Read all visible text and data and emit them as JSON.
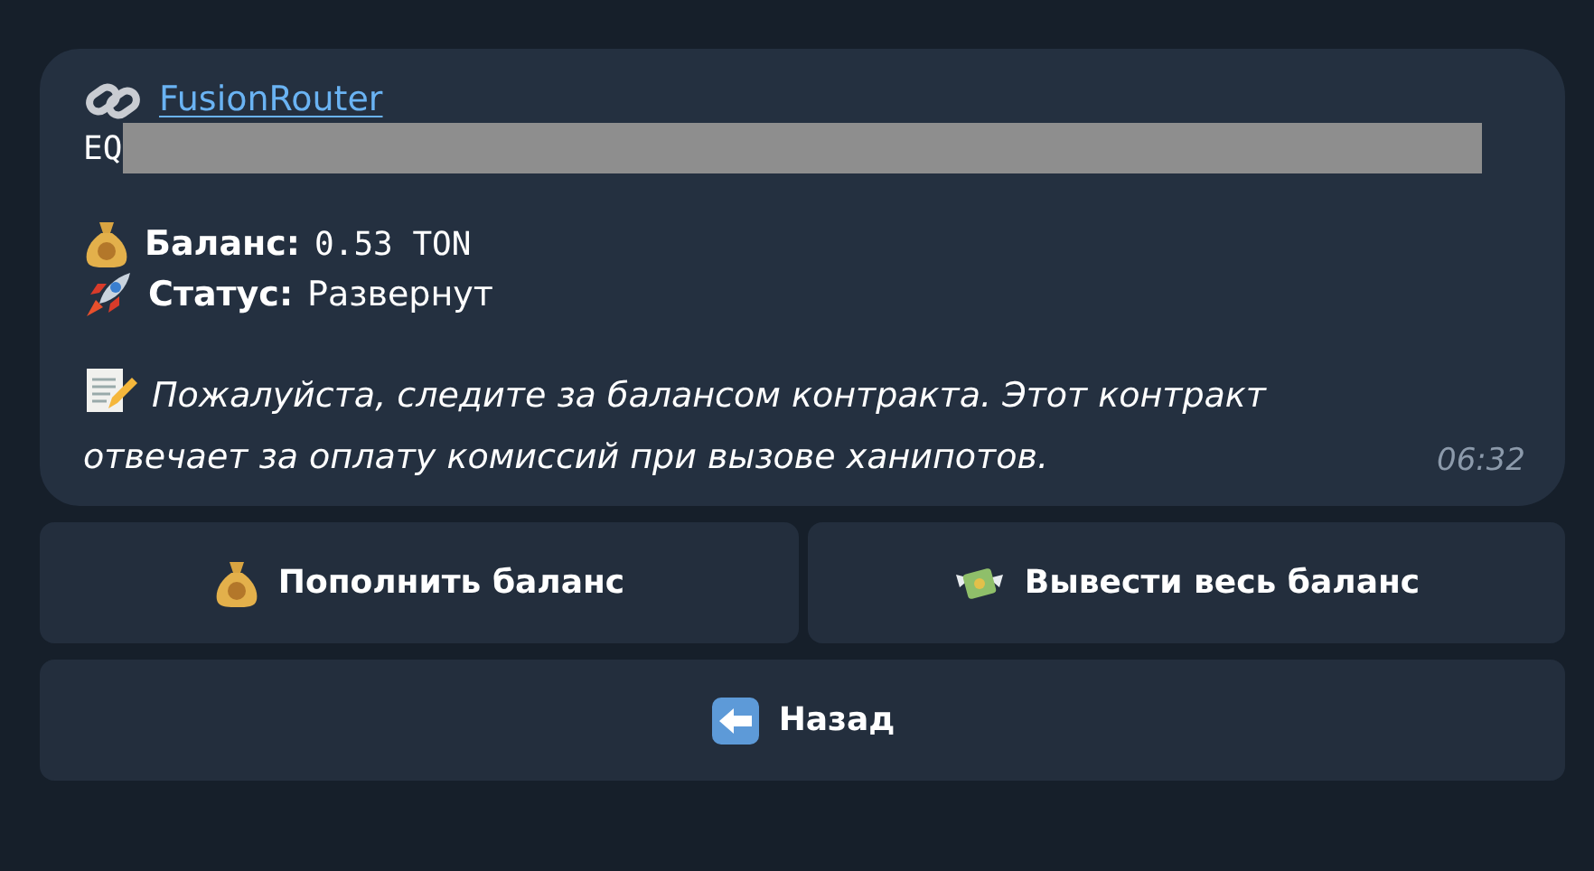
{
  "message": {
    "title_link": "FusionRouter",
    "address": {
      "text": "EQ",
      "redacted": true
    },
    "fields": [
      {
        "kind": "balance",
        "label": "Баланс:",
        "value": "0.53 TON"
      },
      {
        "kind": "status",
        "label": "Статус:",
        "value": "Развернут"
      }
    ],
    "note": "Пожалуйста, следите за балансом контракта. Этот контракт отвечает за оплату комиссий при вызове ханипотов.",
    "time": "06:32"
  },
  "buttons": [
    [
      {
        "kind": "deposit",
        "label": "Пополнить баланс"
      },
      {
        "kind": "withdraw",
        "label": "Вывести весь баланс"
      }
    ],
    [
      {
        "kind": "back",
        "label": "Назад"
      }
    ]
  ]
}
